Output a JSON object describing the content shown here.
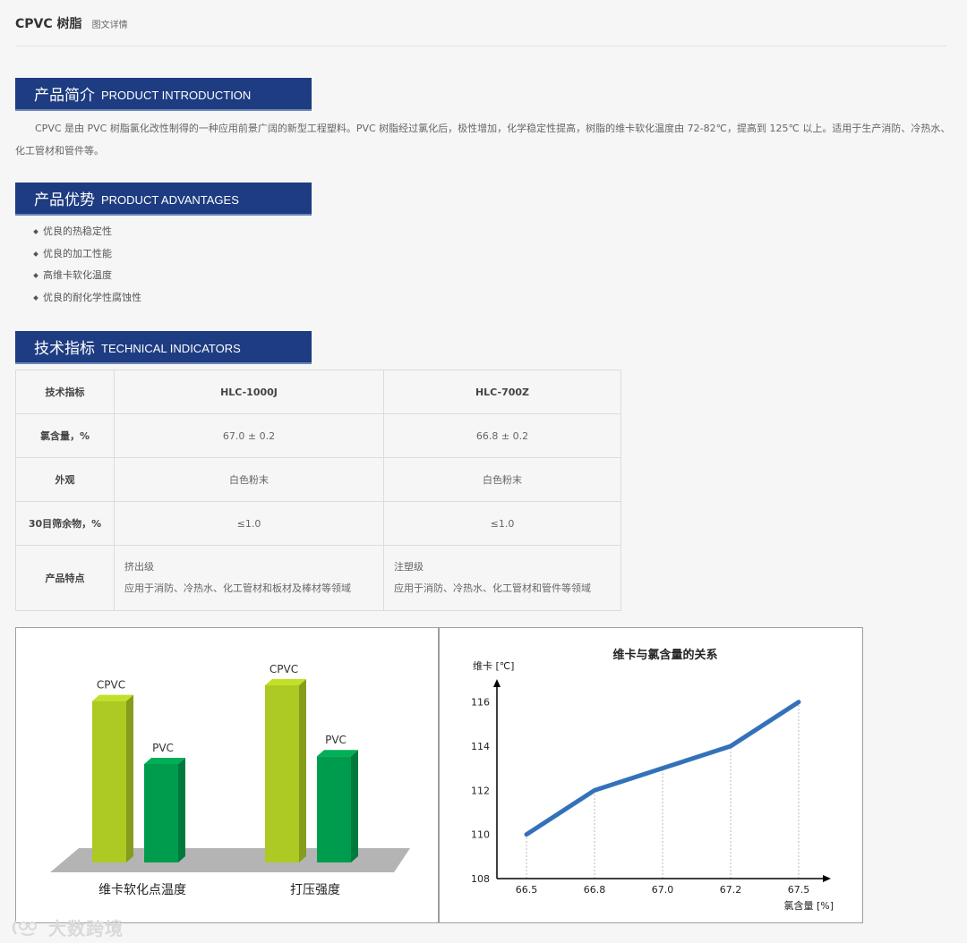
{
  "header": {
    "title": "CPVC 树脂",
    "subtitle": "图文详情"
  },
  "sections": {
    "intro": {
      "cn": "产品简介",
      "en": "PRODUCT INTRODUCTION"
    },
    "advantages": {
      "cn": "产品优势",
      "en": "PRODUCT ADVANTAGES"
    },
    "technical": {
      "cn": "技术指标",
      "en": "TECHNICAL INDICATORS"
    }
  },
  "intro_text": "CPVC 是由 PVC 树脂氯化改性制得的一种应用前景广阔的新型工程塑料。PVC 树脂经过氯化后，极性增加，化学稳定性提高，树脂的维卡软化温度由 72-82℃，提高到 125℃ 以上。适用于生产消防、冷热水、化工管材和管件等。",
  "advantages": [
    "优良的热稳定性",
    "优良的加工性能",
    "高维卡软化温度",
    "优良的耐化学性腐蚀性"
  ],
  "table": {
    "headers": [
      "技术指标",
      "HLC-1000J",
      "HLC-700Z"
    ],
    "rows": [
      {
        "label": "氯含量，%",
        "c1": "67.0 ± 0.2",
        "c2": "66.8 ± 0.2"
      },
      {
        "label": "外观",
        "c1": "白色粉末",
        "c2": "白色粉末"
      },
      {
        "label": "30目筛余物，%",
        "c1": "≤1.0",
        "c2": "≤1.0"
      }
    ],
    "feature_row": {
      "label": "产品特点",
      "c1_line1": "挤出级",
      "c1_line2": "应用于消防、冷热水、化工管材和板材及棒材等领域",
      "c2_line1": "注塑级",
      "c2_line2": "应用于消防、冷热水、化工管材和管件等领域"
    }
  },
  "colors": {
    "banner": "#1e3c82",
    "cpvc_bar": "#acc924",
    "pvc_bar": "#009c4d",
    "line": "#3372b9"
  },
  "chart_data": [
    {
      "type": "bar",
      "categories": [
        "维卡软化点温度",
        "打压强度"
      ],
      "series": [
        {
          "name": "CPVC",
          "values": [
            0.82,
            0.9
          ]
        },
        {
          "name": "PVC",
          "values": [
            0.5,
            0.54
          ]
        }
      ],
      "title": "",
      "xlabel": "",
      "ylabel": ""
    },
    {
      "type": "line",
      "title": "维卡与氯含量的关系",
      "xlabel": "氯含量 [%]",
      "ylabel": "维卡 [℃]",
      "x": [
        "66.5",
        "66.8",
        "67.0",
        "67.2",
        "67.5"
      ],
      "y": [
        110,
        112,
        113,
        114,
        116
      ],
      "ylim": [
        108,
        117
      ],
      "yticks": [
        "108",
        "110",
        "112",
        "114",
        "116"
      ],
      "grid": "vertical-dotted"
    }
  ],
  "watermark": "大数跨境"
}
